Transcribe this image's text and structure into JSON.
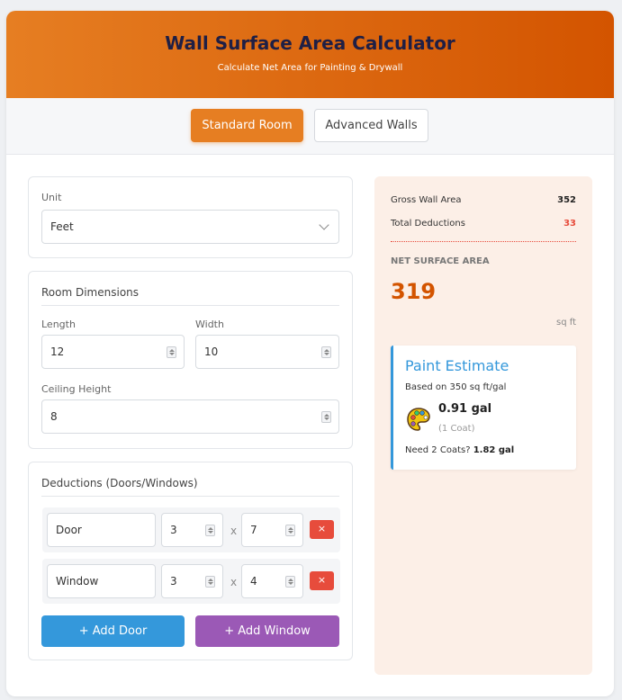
{
  "header": {
    "title": "Wall Surface Area Calculator",
    "subtitle": "Calculate Net Area for Painting & Drywall"
  },
  "tabs": [
    {
      "label": "Standard Room",
      "active": true
    },
    {
      "label": "Advanced Walls",
      "active": false
    }
  ],
  "unit": {
    "label": "Unit",
    "value": "Feet"
  },
  "room": {
    "title": "Room Dimensions",
    "length": {
      "label": "Length",
      "value": "12"
    },
    "width": {
      "label": "Width",
      "value": "10"
    },
    "height": {
      "label": "Ceiling Height",
      "value": "8"
    }
  },
  "deductions": {
    "title": "Deductions (Doors/Windows)",
    "rows": [
      {
        "name": "Door",
        "w": "3",
        "h": "7"
      },
      {
        "name": "Window",
        "w": "3",
        "h": "4"
      }
    ],
    "times": "x",
    "remove": "×",
    "add_door": "+ Add Door",
    "add_window": "+ Add Window"
  },
  "results": {
    "gross_label": "Gross Wall Area",
    "gross_value": "352",
    "deduct_label": "Total Deductions",
    "deduct_value": "33",
    "net_label": "NET SURFACE AREA",
    "net_value": "319",
    "unit": "sq ft"
  },
  "paint": {
    "title": "Paint Estimate",
    "basis": "Based on 350 sq ft/gal",
    "gallons": "0.91 gal",
    "coat": "(1 Coat)",
    "two_coats_label": "Need 2 Coats?",
    "two_coats_value": "1.82 gal"
  },
  "colors": {
    "accent": "#e67e22",
    "net_value": "#d35400",
    "deduction": "#e74c3c",
    "add_door": "#3498db",
    "add_window": "#9b59b6",
    "paint_title": "#3498db"
  }
}
